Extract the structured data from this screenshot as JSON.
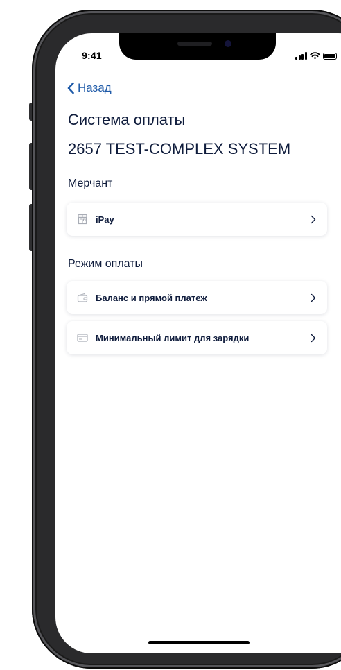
{
  "status_bar": {
    "time": "9:41"
  },
  "nav": {
    "back_label": "Назад"
  },
  "header": {
    "title": "Система оплаты",
    "subtitle": "2657 TEST-COMPLEX SYSTEM"
  },
  "merchant_section": {
    "label": "Мерчант",
    "items": [
      {
        "label": "iPay",
        "icon": "store-icon"
      }
    ]
  },
  "payment_mode_section": {
    "label": "Режим оплаты",
    "items": [
      {
        "label": "Баланс и прямой платеж",
        "icon": "wallet-icon"
      },
      {
        "label": "Минимальный лимит для зарядки",
        "icon": "card-icon"
      }
    ]
  },
  "colors": {
    "accent": "#1e5aa8",
    "text_primary": "#0f1c3c",
    "icon_gray": "#a9adb6"
  }
}
